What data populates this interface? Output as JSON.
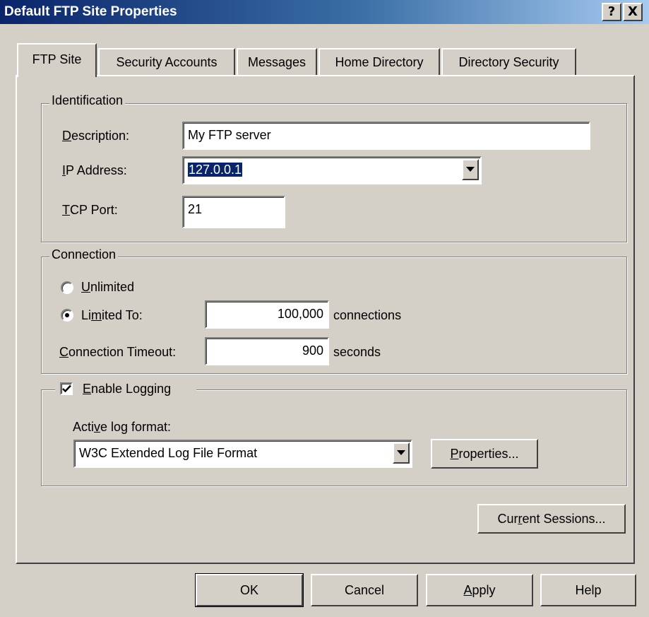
{
  "window": {
    "title": "Default FTP Site Properties",
    "help_button": "?",
    "close_button": "X"
  },
  "tabs": [
    {
      "label": "FTP Site",
      "active": true
    },
    {
      "label": "Security Accounts",
      "active": false
    },
    {
      "label": "Messages",
      "active": false
    },
    {
      "label": "Home Directory",
      "active": false
    },
    {
      "label": "Directory Security",
      "active": false
    }
  ],
  "identification": {
    "legend": "Identification",
    "description": {
      "mnemonic": "D",
      "label_rest": "escription:",
      "value": "My FTP server"
    },
    "ip_address": {
      "mnemonic": "I",
      "label_rest": "P Address:",
      "value": "127.0.0.1"
    },
    "tcp_port": {
      "mnemonic": "T",
      "label_rest": "CP Port:",
      "value": "21"
    }
  },
  "connection": {
    "legend": "Connection",
    "unlimited": {
      "mnemonic": "U",
      "label_rest": "nlimited",
      "selected": false
    },
    "limited_to": {
      "label_pre": "Li",
      "mnemonic": "m",
      "label_post": "ited To:",
      "selected": true,
      "value": "100,000",
      "unit": "connections"
    },
    "timeout": {
      "mnemonic": "C",
      "label_rest": "onnection Timeout:",
      "value": "900",
      "unit": "seconds"
    }
  },
  "logging": {
    "enable": {
      "mnemonic": "E",
      "label_rest": "nable Logging",
      "checked": true
    },
    "format_label": {
      "pre": "Acti",
      "mnemonic": "v",
      "post": "e log format:"
    },
    "format_value": "W3C Extended Log File Format",
    "properties_button": {
      "mnemonic": "P",
      "rest": "roperties..."
    }
  },
  "current_sessions_button": {
    "pre": "Cur",
    "mnemonic": "r",
    "post": "ent Sessions..."
  },
  "footer": {
    "ok": "OK",
    "cancel": "Cancel",
    "apply": {
      "mnemonic": "A",
      "rest": "pply"
    },
    "help": "Help"
  },
  "colors": {
    "titlebar_start": "#0a246a",
    "titlebar_end": "#a6caf0",
    "face": "#d4d0c8",
    "selection": "#0a246a"
  }
}
